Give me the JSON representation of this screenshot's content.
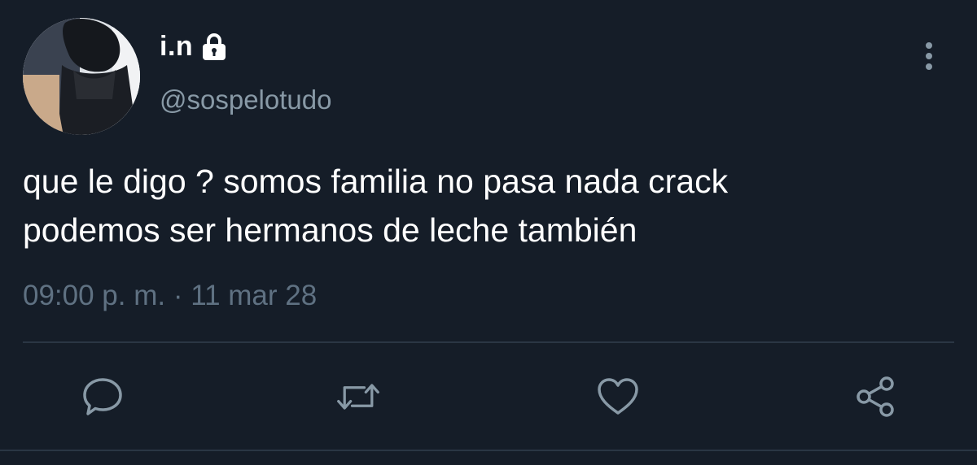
{
  "user": {
    "display_name": "i.n",
    "handle": "@sospelotudo",
    "protected_icon": "lock-icon",
    "avatar": "profile-photo"
  },
  "tweet": {
    "text": "que le digo ? somos familia no pasa nada crack\npodemos ser hermanos de leche también",
    "timestamp": "09:00 p. m. · 11 mar 28"
  },
  "actions": [
    {
      "name": "reply",
      "icon": "reply-icon"
    },
    {
      "name": "retweet",
      "icon": "retweet-icon"
    },
    {
      "name": "like",
      "icon": "heart-icon"
    },
    {
      "name": "share",
      "icon": "share-icon"
    }
  ],
  "menu": {
    "icon": "more-vertical-icon"
  },
  "colors": {
    "background": "#151d28",
    "primary_text": "#ffffff",
    "secondary_text": "#8899a6",
    "meta_text": "#5f7182",
    "icon": "#8899a6",
    "divider": "#2a3644"
  }
}
